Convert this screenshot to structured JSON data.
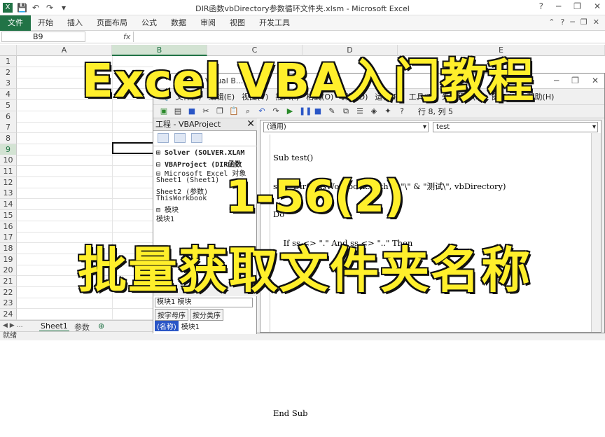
{
  "window": {
    "title": "DIR函数vbDirectory参数循环文件夹.xlsm - Microsoft Excel",
    "controls": [
      "?",
      "─",
      "❐",
      "✕"
    ]
  },
  "ribbon": {
    "file_tab": "文件",
    "tabs": [
      "开始",
      "插入",
      "页面布局",
      "公式",
      "数据",
      "审阅",
      "视图",
      "开发工具"
    ]
  },
  "formula_bar": {
    "name_box": "B9",
    "fx": "fx"
  },
  "grid": {
    "columns": [
      "A",
      "B",
      "C",
      "D",
      "E"
    ],
    "selected_column": "B",
    "rows": [
      "1",
      "2",
      "3",
      "4",
      "5",
      "6",
      "7",
      "8",
      "9",
      "10",
      "11",
      "12",
      "13",
      "14",
      "15",
      "16",
      "17",
      "18",
      "19",
      "20",
      "21",
      "22",
      "23",
      "24"
    ],
    "selected_row": "9"
  },
  "sheet_tabs": [
    "Sheet1",
    "参数"
  ],
  "status": "就绪",
  "vbe": {
    "title": "Visual B...",
    "menu": [
      "文件(F)",
      "编辑(E)",
      "视图(V)",
      "插入(I)",
      "格式(O)",
      "调试(D)",
      "运行(R)",
      "工具(T)",
      "外接程序(A)",
      "窗口(W)",
      "帮助(H)"
    ],
    "cursor_position": "行 8, 列 5",
    "project_title": "工程 - VBAProject",
    "project_tree": [
      "⊞ Solver (SOLVER.XLAM",
      "⊟ VBAProject (DIR函数",
      "  ⊟ Microsoft Excel 对象",
      "      Sheet1 (Sheet1)",
      "      Sheet2 (参数)",
      "      ThisWorkbook",
      "  ⊟ 模块",
      "      模块1"
    ],
    "properties": {
      "combo": "模块1 模块",
      "tabs": [
        "按字母序",
        "按分类序"
      ],
      "row_key": "(名称)",
      "row_value": "模块1"
    },
    "code": {
      "object_combo": "(通用)",
      "proc_combo": "test",
      "lines": [
        "Sub test()",
        "ss = Dir(ThisWorkbook.Path & \"\\\" & \"测试\\\", vbDirectory)",
        "Do",
        "    If ss <> \".\" And ss <> \"..\" Then",
        "",
        "",
        "",
        "",
        "",
        "End Sub"
      ]
    }
  },
  "overlay": {
    "headline": "Excel VBA入门教程",
    "episode": "1-56(2)",
    "subtitle": "批量获取文件夹名称"
  }
}
